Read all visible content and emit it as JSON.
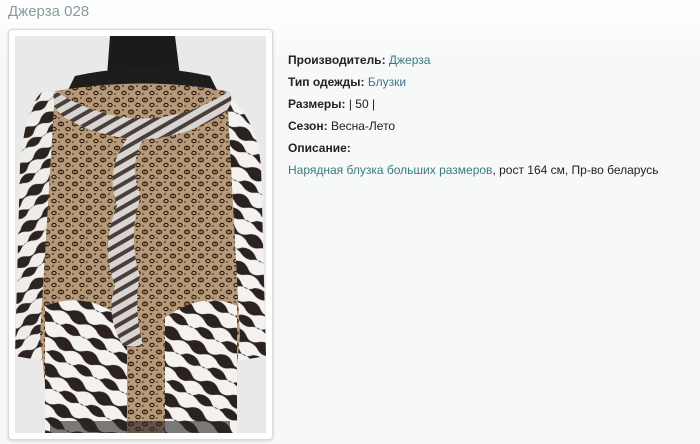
{
  "page": {
    "title": "Джерза 028"
  },
  "product_image": {
    "icon": "blouse-photo-icon"
  },
  "details": {
    "manufacturer_label": "Производитель:",
    "manufacturer_value": "Джерза",
    "type_label": "Тип одежды:",
    "type_value": "Блузки",
    "sizes_label": "Размеры:",
    "sizes_value": "| 50 |",
    "season_label": "Сезон:",
    "season_value": "Весна-Лето",
    "description_label": "Описание:",
    "description_link": "Нарядная блузка больших размеров",
    "description_rest": ", рост 164 см, Пр-во беларусь"
  },
  "colors": {
    "title": "#8a9aa0",
    "link": "#3a7a85"
  }
}
